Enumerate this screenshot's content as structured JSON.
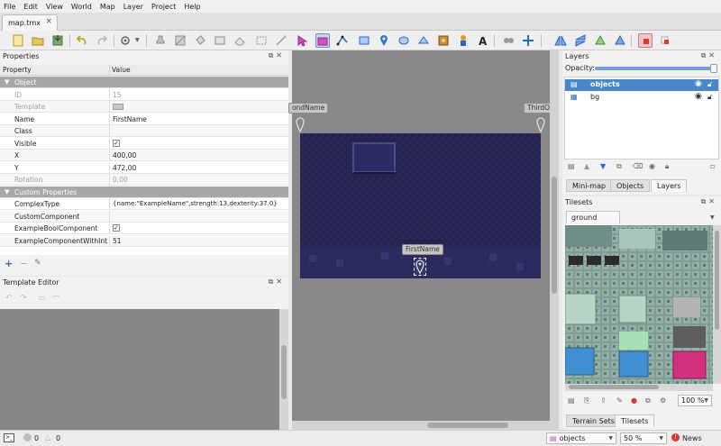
{
  "menu": [
    "File",
    "Edit",
    "View",
    "World",
    "Map",
    "Layer",
    "Project",
    "Help"
  ],
  "document_tab": "map.tmx",
  "properties_panel": {
    "title": "Properties",
    "header_property": "Property",
    "header_value": "Value",
    "groups": [
      {
        "name": "Object",
        "rows": [
          {
            "key": "ID",
            "value": "15",
            "disabled": true
          },
          {
            "key": "Template",
            "value": "",
            "disabled": true,
            "swatch": true
          },
          {
            "key": "Name",
            "value": "FirstName"
          },
          {
            "key": "Class",
            "value": ""
          },
          {
            "key": "Visible",
            "value": "✓",
            "checkbox": true
          },
          {
            "key": "X",
            "value": "400,00"
          },
          {
            "key": "Y",
            "value": "472,00"
          },
          {
            "key": "Rotation",
            "value": "0,00",
            "disabled": true
          }
        ]
      },
      {
        "name": "Custom Properties",
        "rows": [
          {
            "key": "ComplexType",
            "value": "{name:\"ExampleName\",strength:13,dexterity:37.0}"
          },
          {
            "key": "CustomComponent",
            "value": ""
          },
          {
            "key": "ExampleBoolComponent",
            "value": "✓",
            "checkbox": true
          },
          {
            "key": "ExampleComponentWithInt",
            "value": "51"
          }
        ]
      }
    ]
  },
  "template_editor": {
    "title": "Template Editor"
  },
  "map": {
    "objects": [
      {
        "label": "ondName"
      },
      {
        "label": "ThirdOn"
      },
      {
        "label": "FirstName"
      }
    ],
    "background": "#898989",
    "tile_color": "#24244f"
  },
  "layers_panel": {
    "title": "Layers",
    "opacity_label": "Opacity:",
    "opacity": 1.0,
    "layers": [
      {
        "name": "objects",
        "selected": true
      },
      {
        "name": "bg",
        "selected": false
      }
    ],
    "tabs": [
      "Mini-map",
      "Objects",
      "Layers"
    ],
    "active_tab": "Layers"
  },
  "tilesets_panel": {
    "title": "Tilesets",
    "tileset_name": "ground",
    "zoom": "100 %",
    "tabs": [
      "Terrain Sets",
      "Tilesets"
    ],
    "active_tab": "Tilesets"
  },
  "status": {
    "errors": "0",
    "warnings": "0",
    "layer_select": "objects",
    "zoom": "50 %",
    "news": "News"
  },
  "colors": {
    "selection": "#4a87c9",
    "accent": "#6e8cc4",
    "news_icon": "#d83b2e"
  }
}
